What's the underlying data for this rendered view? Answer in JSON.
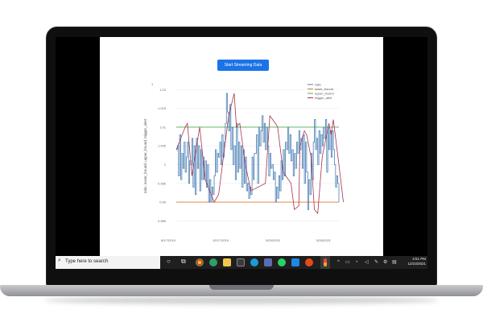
{
  "page": {
    "stream_button_label": "Start Streaming Data"
  },
  "chart_data": {
    "type": "line",
    "title": "",
    "xlabel": "",
    "ylabel": "ratio, lower_bound, upper_bound, trigger_alert",
    "ylim": [
      0.9825,
      1.022
    ],
    "x_tick_labels": [
      "8/17/2019",
      "12/17/2019",
      "5/20/2020",
      "5/26/2021"
    ],
    "y_ticks": [
      0.985,
      0.99,
      0.995,
      1.0,
      1.005,
      1.01,
      1.015,
      1.02
    ],
    "y_tick_labels": [
      "0.985",
      "0.99",
      "0.995",
      "1",
      "1.005",
      "1.01",
      "1.015",
      "1.02"
    ],
    "extra_tick_label": "1",
    "grid": true,
    "legend_position": "top-right",
    "series": [
      {
        "name": "ratio",
        "color": "#4a7fb5",
        "values": [
          1.004,
          1.005,
          0.997,
          1.008,
          0.996,
          1.003,
          0.999,
          1.006,
          0.998,
          1.002,
          1.006,
          0.995,
          1.001,
          1.0,
          1.007,
          0.994,
          1.005,
          0.992,
          1.007,
          0.999,
          1.005,
          0.993,
          1.004,
          0.996,
          1.002,
          0.996,
          1.001,
          0.994,
          1.0,
          0.99,
          0.996,
          0.99,
          0.994,
          0.992,
          0.997,
          1.004,
          0.998,
          1.003,
          1.002,
          1.006,
          1.0,
          1.008,
          1.002,
          1.006,
          1.011,
          1.019,
          1.014,
          1.009,
          1.016,
          1.004,
          1.01,
          1.0,
          1.005,
          0.996,
          1.011,
          0.998,
          1.006,
          0.999,
          1.005,
          0.994,
          1.004,
          0.995,
          1.002,
          0.993,
          0.995,
          0.991,
          0.994,
          0.992,
          1.002,
          0.996,
          1.003,
          1.003,
          1.008,
          0.995,
          1.01,
          1.005,
          1.009,
          1.013,
          1.006,
          1.011,
          1.004,
          1.01,
          1.005,
          0.997,
          1.003,
          0.999,
          1.0,
          0.996,
          0.998,
          0.99,
          0.994,
          0.991,
          0.997,
          0.993,
          1.001,
          0.996,
          1.004,
          0.997,
          1.006,
          1.004,
          1.01,
          1.003,
          1.008,
          1.001,
          1.004,
          0.997,
          1.003,
          0.999,
          1.006,
          1.003,
          1.009,
          1.004,
          1.007,
          0.999,
          1.008,
          0.995,
          1.006,
          0.998,
          0.988,
          0.996,
          0.992,
          1.003,
          0.996,
          1.006,
          1.012,
          1.004,
          1.007,
          1.0,
          1.009,
          1.003,
          1.008,
          1.005,
          1.01,
          1.007,
          1.012,
          0.998,
          1.01,
          1.004,
          1.009,
          1.002,
          1.009,
          1.004,
          1.0,
          0.994,
          0.997,
          0.995,
          0.99
        ]
      },
      {
        "name": "lower_bound",
        "color": "#e07a2e",
        "values": [
          0.99,
          0.99
        ]
      },
      {
        "name": "upper_bound",
        "color": "#4caf50",
        "values": [
          1.01,
          1.01
        ]
      },
      {
        "name": "trigger_alert",
        "color": "#a8334e",
        "x": [
          0,
          8,
          10,
          14,
          21,
          26,
          34,
          38,
          47,
          52,
          54,
          57,
          62,
          67,
          80,
          84,
          89,
          91,
          96,
          103,
          106,
          110,
          111,
          115,
          117,
          121,
          124,
          127,
          131,
          137,
          139,
          141,
          146,
          150
        ],
        "values": [
          1.004,
          1.01,
          1.011,
          0.997,
          1.01,
          0.996,
          0.99,
          0.992,
          1.013,
          1.019,
          1.01,
          1.011,
          1.0,
          0.993,
          0.995,
          1.013,
          1.011,
          1.01,
          0.998,
          0.995,
          0.988,
          0.989,
          1.005,
          1.009,
          1.008,
          1.002,
          0.988,
          0.987,
          1.002,
          1.011,
          1.008,
          1.012,
          1.0,
          0.99
        ]
      }
    ]
  },
  "taskbar": {
    "search_placeholder": "Type here to search",
    "time": "4:51 PM",
    "date": "12/23/2021"
  },
  "icons": {
    "search": "search-icon",
    "start": "windows-start-icon",
    "cortana": "cortana-icon",
    "taskview": "task-view-icon",
    "chrome": "chrome-icon",
    "edge": "edge-icon",
    "explorer": "file-explorer-icon",
    "terminal": "terminal-icon",
    "whatsapp": "whatsapp-icon",
    "vscode": "vscode-icon",
    "anaconda": "anaconda-icon",
    "python": "python-icon"
  }
}
